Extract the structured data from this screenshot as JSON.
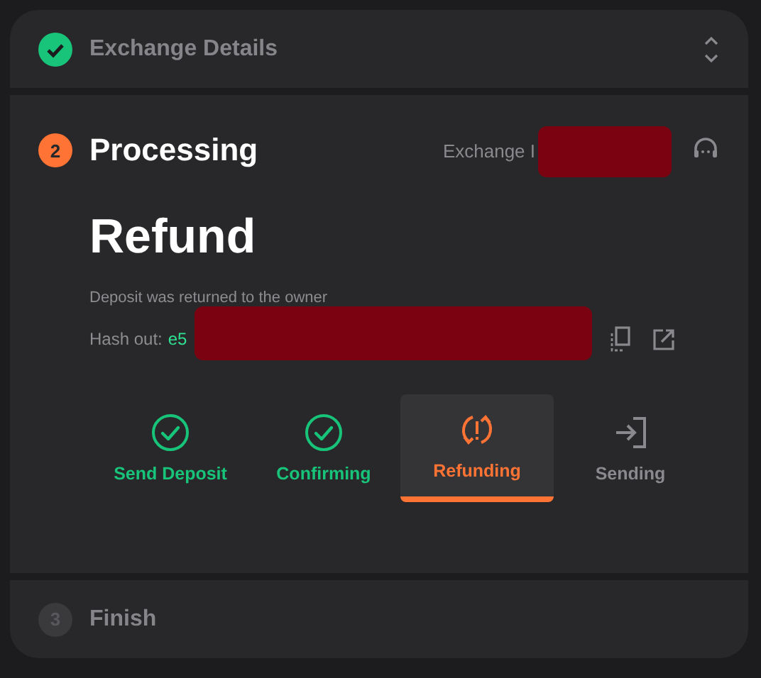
{
  "sections": [
    {
      "kind": "done",
      "title": "Exchange Details"
    },
    {
      "kind": "active",
      "number": "2",
      "title": "Processing",
      "exchange_id_label": "Exchange I",
      "heading": "Refund",
      "description": "Deposit was returned to the owner",
      "hash_label": "Hash out:",
      "hash_value": "e5",
      "steps": [
        {
          "label": "Send Deposit",
          "kind": "done",
          "selected": false
        },
        {
          "label": "Confirming",
          "kind": "done",
          "selected": false
        },
        {
          "label": "Refunding",
          "kind": "refund",
          "selected": true
        },
        {
          "label": "Sending",
          "kind": "pending",
          "selected": false
        }
      ]
    },
    {
      "kind": "pending",
      "number": "3",
      "title": "Finish"
    }
  ]
}
